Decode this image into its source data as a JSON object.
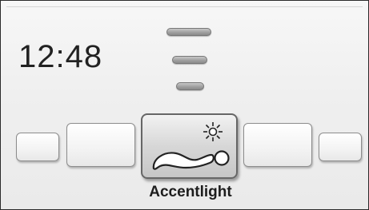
{
  "clock": {
    "time": "12:48"
  },
  "light_level": {
    "steps": 3
  },
  "menu": {
    "selected_label": "Accentlight",
    "selected_icon": "person-lying-with-light-icon"
  }
}
